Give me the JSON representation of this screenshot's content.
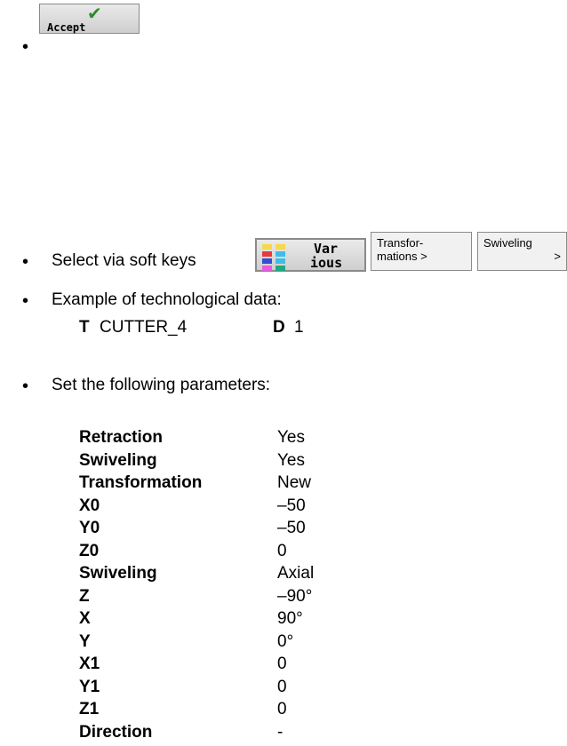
{
  "accept_button": {
    "label": "Accept"
  },
  "softkeys": {
    "lead_text": "Select via soft keys",
    "various": {
      "line1": "Var",
      "line2": "ious"
    },
    "transformations": {
      "line1": "Transfor-",
      "line2": "mations >"
    },
    "swiveling": {
      "line1": "Swiveling",
      "line2": ">"
    }
  },
  "tech_data": {
    "heading": "Example of technological data:",
    "tool_key": "T",
    "tool_value": "CUTTER_4",
    "d_key": "D",
    "d_value": "1"
  },
  "params": {
    "heading": "Set the following parameters:",
    "rows": [
      {
        "name": "Retraction",
        "value": "Yes"
      },
      {
        "name": "Swiveling",
        "value": "Yes"
      },
      {
        "name": "Transformation",
        "value": "New"
      },
      {
        "name": "X0",
        "value": "–50"
      },
      {
        "name": "Y0",
        "value": "–50"
      },
      {
        "name": "Z0",
        "value": "0"
      },
      {
        "name": "Swiveling",
        "value": "Axial"
      },
      {
        "name": "Z",
        "value": "–90°"
      },
      {
        "name": "X",
        "value": "90°"
      },
      {
        "name": "Y",
        "value": "0°"
      },
      {
        "name": "X1",
        "value": "0"
      },
      {
        "name": "Y1",
        "value": "0"
      },
      {
        "name": "Z1",
        "value": "0"
      },
      {
        "name": "Direction",
        "value": "-"
      }
    ]
  }
}
